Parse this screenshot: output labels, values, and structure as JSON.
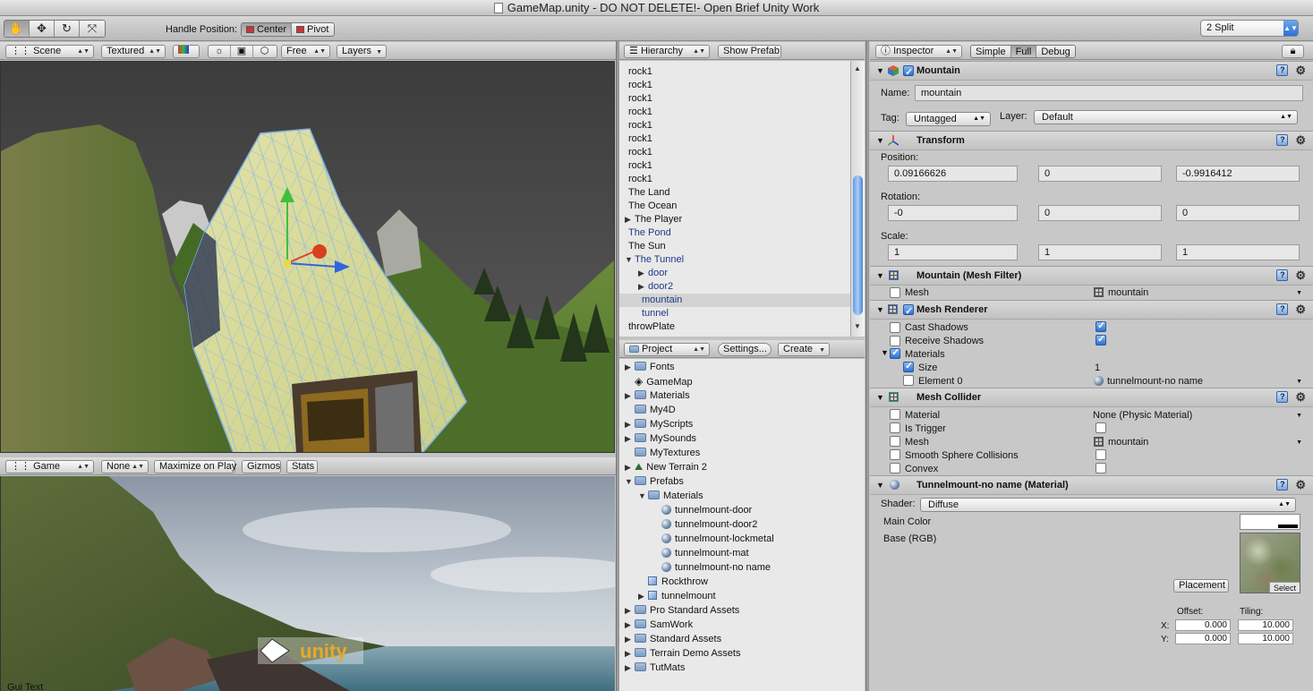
{
  "window": {
    "title": "GameMap.unity - DO NOT DELETE!- Open Brief Unity Work"
  },
  "toolbar": {
    "tools": [
      "hand-icon",
      "move-icon",
      "rotate-icon",
      "scale-icon"
    ],
    "handle_position_label": "Handle Position:",
    "handle_center": "Center",
    "handle_pivot": "Pivot",
    "layout": "2 Split"
  },
  "scene": {
    "tab": "Scene",
    "render_mode": "Textured",
    "projection": "Free",
    "layers": "Layers"
  },
  "game": {
    "tab": "Game",
    "aspect": "None",
    "maximize_on_play": "Maximize on Play",
    "gizmos": "Gizmos",
    "stats": "Stats",
    "gui_text": "Gui Text",
    "logo_text": "unity"
  },
  "hierarchy": {
    "tab": "Hierarchy",
    "show_prefab": "Show Prefab",
    "items": [
      {
        "label": "rock1",
        "indent": 0,
        "expander": "",
        "blue": false,
        "selected": false
      },
      {
        "label": "rock1",
        "indent": 0,
        "expander": "",
        "blue": false,
        "selected": false
      },
      {
        "label": "rock1",
        "indent": 0,
        "expander": "",
        "blue": false,
        "selected": false
      },
      {
        "label": "rock1",
        "indent": 0,
        "expander": "",
        "blue": false,
        "selected": false
      },
      {
        "label": "rock1",
        "indent": 0,
        "expander": "",
        "blue": false,
        "selected": false
      },
      {
        "label": "rock1",
        "indent": 0,
        "expander": "",
        "blue": false,
        "selected": false
      },
      {
        "label": "rock1",
        "indent": 0,
        "expander": "",
        "blue": false,
        "selected": false
      },
      {
        "label": "rock1",
        "indent": 0,
        "expander": "",
        "blue": false,
        "selected": false
      },
      {
        "label": "rock1",
        "indent": 0,
        "expander": "",
        "blue": false,
        "selected": false
      },
      {
        "label": "The Land",
        "indent": 0,
        "expander": "",
        "blue": false,
        "selected": false
      },
      {
        "label": "The Ocean",
        "indent": 0,
        "expander": "",
        "blue": false,
        "selected": false
      },
      {
        "label": "The Player",
        "indent": 0,
        "expander": "▶",
        "blue": false,
        "selected": false
      },
      {
        "label": "The Pond",
        "indent": 0,
        "expander": "",
        "blue": true,
        "selected": false
      },
      {
        "label": "The Sun",
        "indent": 0,
        "expander": "",
        "blue": false,
        "selected": false
      },
      {
        "label": "The Tunnel",
        "indent": 0,
        "expander": "▼",
        "blue": true,
        "selected": false
      },
      {
        "label": "door",
        "indent": 1,
        "expander": "▶",
        "blue": true,
        "selected": false
      },
      {
        "label": "door2",
        "indent": 1,
        "expander": "▶",
        "blue": true,
        "selected": false
      },
      {
        "label": "mountain",
        "indent": 1,
        "expander": "",
        "blue": true,
        "selected": true
      },
      {
        "label": "tunnel",
        "indent": 1,
        "expander": "",
        "blue": true,
        "selected": false
      },
      {
        "label": "throwPlate",
        "indent": 0,
        "expander": "",
        "blue": false,
        "selected": false
      }
    ]
  },
  "project": {
    "tab": "Project",
    "settings": "Settings...",
    "create": "Create",
    "items": [
      {
        "label": "Fonts",
        "indent": 0,
        "expander": "▶",
        "icon": "folder"
      },
      {
        "label": "GameMap",
        "indent": 0,
        "expander": "",
        "icon": "unity"
      },
      {
        "label": "Materials",
        "indent": 0,
        "expander": "▶",
        "icon": "folder"
      },
      {
        "label": "My4D",
        "indent": 0,
        "expander": "",
        "icon": "folder"
      },
      {
        "label": "MyScripts",
        "indent": 0,
        "expander": "▶",
        "icon": "folder"
      },
      {
        "label": "MySounds",
        "indent": 0,
        "expander": "▶",
        "icon": "folder"
      },
      {
        "label": "MyTextures",
        "indent": 0,
        "expander": "",
        "icon": "folder"
      },
      {
        "label": "New Terrain 2",
        "indent": 0,
        "expander": "▶",
        "icon": "terrain"
      },
      {
        "label": "Prefabs",
        "indent": 0,
        "expander": "▼",
        "icon": "folder"
      },
      {
        "label": "Materials",
        "indent": 1,
        "expander": "▼",
        "icon": "folder"
      },
      {
        "label": "tunnelmount-door",
        "indent": 2,
        "expander": "",
        "icon": "sphere"
      },
      {
        "label": "tunnelmount-door2",
        "indent": 2,
        "expander": "",
        "icon": "sphere"
      },
      {
        "label": "tunnelmount-lockmetal",
        "indent": 2,
        "expander": "",
        "icon": "sphere"
      },
      {
        "label": "tunnelmount-mat",
        "indent": 2,
        "expander": "",
        "icon": "sphere"
      },
      {
        "label": "tunnelmount-no name",
        "indent": 2,
        "expander": "",
        "icon": "sphere"
      },
      {
        "label": "Rockthrow",
        "indent": 1,
        "expander": "",
        "icon": "cube"
      },
      {
        "label": "tunnelmount",
        "indent": 1,
        "expander": "▶",
        "icon": "cube"
      },
      {
        "label": "Pro Standard Assets",
        "indent": 0,
        "expander": "▶",
        "icon": "folder"
      },
      {
        "label": "SamWork",
        "indent": 0,
        "expander": "▶",
        "icon": "folder"
      },
      {
        "label": "Standard Assets",
        "indent": 0,
        "expander": "▶",
        "icon": "folder"
      },
      {
        "label": "Terrain Demo Assets",
        "indent": 0,
        "expander": "▶",
        "icon": "folder"
      },
      {
        "label": "TutMats",
        "indent": 0,
        "expander": "▶",
        "icon": "folder"
      }
    ]
  },
  "inspector": {
    "tab": "Inspector",
    "modes": [
      "Simple",
      "Full",
      "Debug"
    ],
    "object": {
      "title": "Mountain",
      "name_label": "Name:",
      "name": "mountain",
      "tag_label": "Tag:",
      "tag": "Untagged",
      "layer_label": "Layer:",
      "layer": "Default"
    },
    "transform": {
      "title": "Transform",
      "position_label": "Position:",
      "position": [
        "0.09166626",
        "0",
        "-0.9916412"
      ],
      "rotation_label": "Rotation:",
      "rotation": [
        "-0",
        "0",
        "0"
      ],
      "scale_label": "Scale:",
      "scale": [
        "1",
        "1",
        "1"
      ]
    },
    "mesh_filter": {
      "title": "Mountain (Mesh Filter)",
      "mesh_label": "Mesh",
      "mesh_value": "mountain"
    },
    "mesh_renderer": {
      "title": "Mesh Renderer",
      "cast_shadows": "Cast Shadows",
      "receive_shadows": "Receive Shadows",
      "materials": "Materials",
      "size_label": "Size",
      "size_value": "1",
      "element0_label": "Element 0",
      "element0_value": "tunnelmount-no name"
    },
    "mesh_collider": {
      "title": "Mesh Collider",
      "material_label": "Material",
      "material_value": "None (Physic Material)",
      "is_trigger": "Is Trigger",
      "mesh_label": "Mesh",
      "mesh_value": "mountain",
      "smooth_sphere": "Smooth Sphere Collisions",
      "convex": "Convex"
    },
    "material": {
      "title": "Tunnelmount-no name (Material)",
      "shader_label": "Shader:",
      "shader": "Diffuse",
      "main_color": "Main Color",
      "base_rgb": "Base (RGB)",
      "placement": "Placement",
      "select": "Select",
      "offset_label": "Offset:",
      "tiling_label": "Tiling:",
      "x_label": "X:",
      "y_label": "Y:",
      "offset_x": "0.000",
      "offset_y": "0.000",
      "tiling_x": "10.000",
      "tiling_y": "10.000"
    }
  }
}
